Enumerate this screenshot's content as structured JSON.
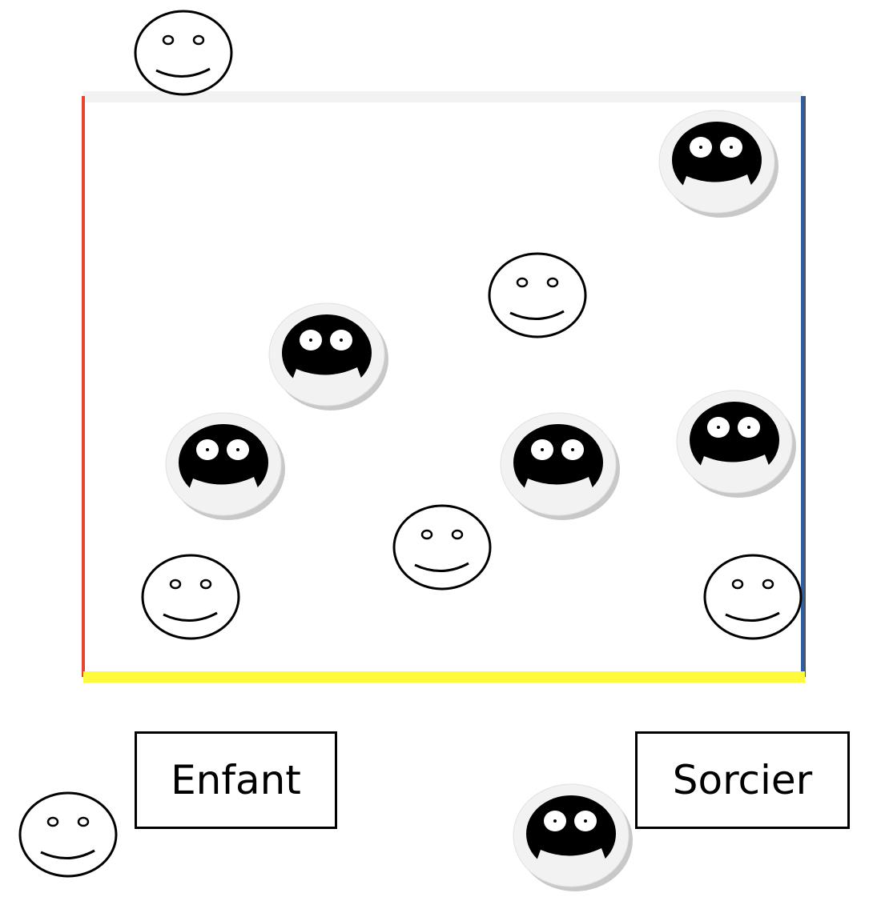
{
  "field": {
    "border_colors": {
      "top": "#f2f2f2",
      "left": "#e8432e",
      "right": "#2e5fa5",
      "bottom": "#fffb3c"
    }
  },
  "pieces": {
    "child_fill": "#ffffff",
    "sorcerer_fill": "#000000",
    "sorcerer_disc": "#f2f2f2",
    "sorcerer_shadow": "#c8c8c8"
  },
  "legend": {
    "child_label": "Enfant",
    "sorcerer_label": "Sorcier"
  }
}
